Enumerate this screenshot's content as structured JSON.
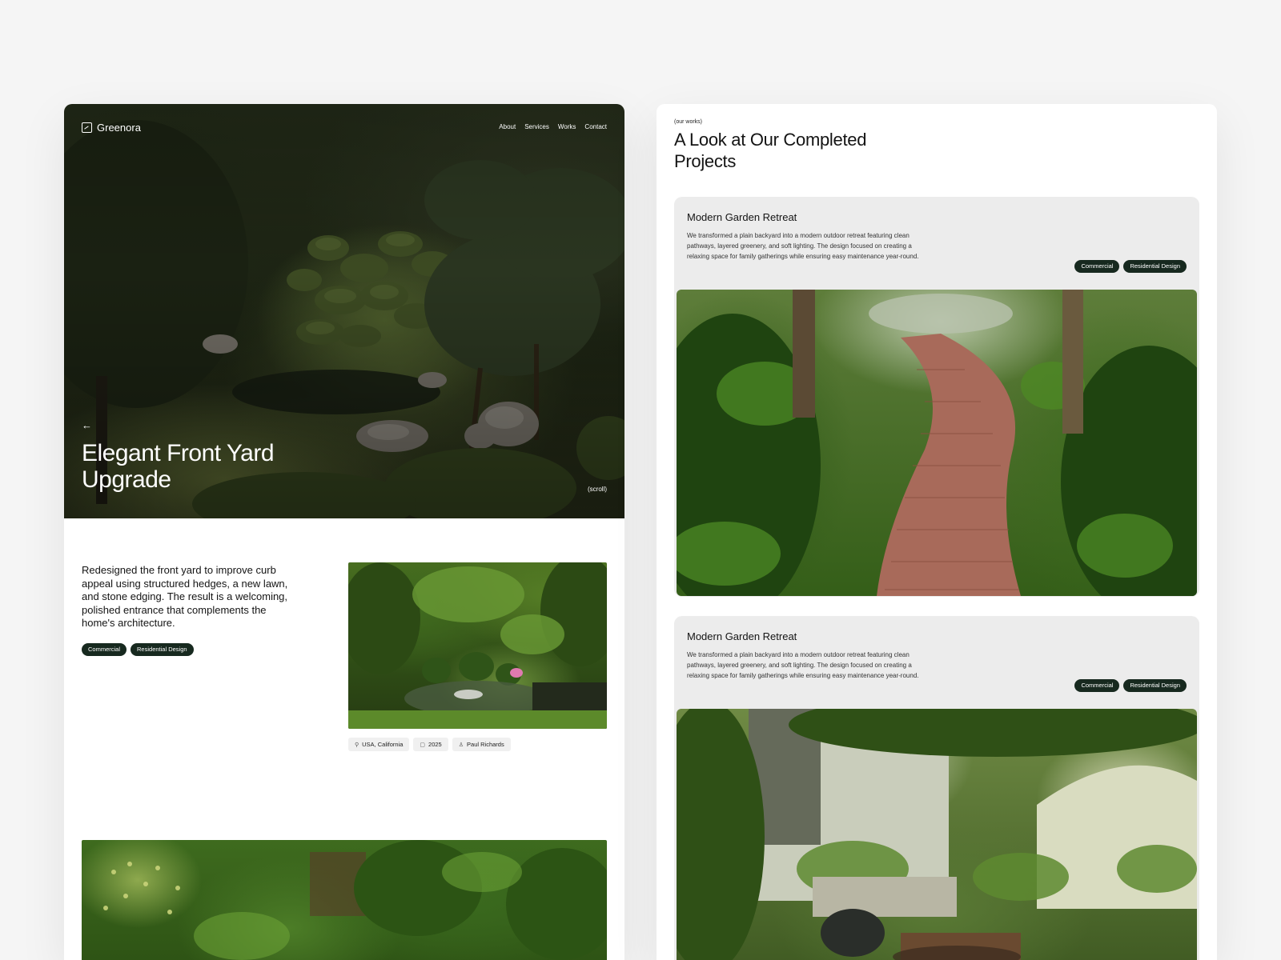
{
  "project_page": {
    "brand": "Greenora",
    "nav": [
      "About",
      "Services",
      "Works",
      "Contact"
    ],
    "back_arrow": "←",
    "hero_title": "Elegant Front Yard Upgrade",
    "scroll_hint": "(scroll)",
    "description": "Redesigned the front yard to improve curb appeal using structured hedges, a new lawn, and stone edging. The result is a welcoming, polished entrance that complements the home's architecture.",
    "tags": [
      "Commercial",
      "Residential Design"
    ],
    "meta": {
      "location": "USA, California",
      "year": "2025",
      "author": "Paul Richards"
    }
  },
  "works_page": {
    "eyebrow": "(our works)",
    "title": "A Look at Our Completed Projects",
    "projects": [
      {
        "title": "Modern Garden Retreat",
        "description": "We transformed a plain backyard into a modern outdoor retreat featuring clean pathways, layered greenery, and soft lighting. The design focused on creating a relaxing space for family gatherings while ensuring easy maintenance year-round.",
        "tags": [
          "Commercial",
          "Residential Design"
        ]
      },
      {
        "title": "Modern Garden Retreat",
        "description": "We transformed a plain backyard into a modern outdoor retreat featuring clean pathways, layered greenery, and soft lighting. The design focused on creating a relaxing space for family gatherings while ensuring easy maintenance year-round.",
        "tags": [
          "Commercial",
          "Residential Design"
        ]
      }
    ]
  },
  "colors": {
    "page_background": "#f5f5f5",
    "panel_background": "#ffffff",
    "tag_background": "#17291f",
    "card_background": "#ececec",
    "text": "#141414"
  },
  "icons": {
    "logo": "leaf-square-icon",
    "location": "pin-icon",
    "year": "calendar-icon",
    "author": "person-icon"
  }
}
